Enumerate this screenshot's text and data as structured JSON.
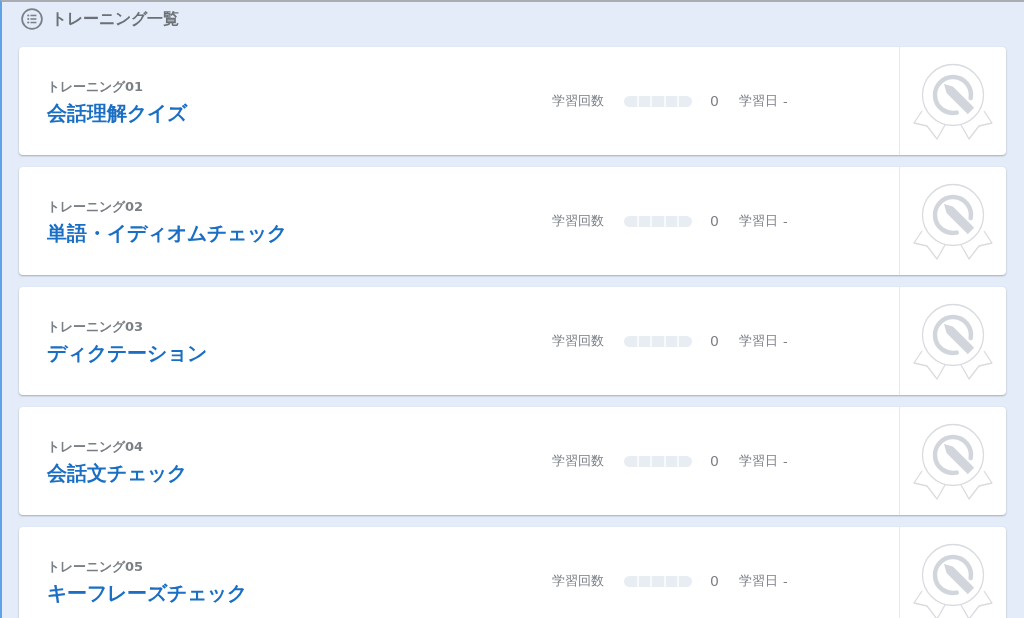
{
  "section": {
    "title": "トレーニング一覧"
  },
  "trainings": [
    {
      "number": "トレーニング01",
      "title": "会話理解クイズ",
      "count_label": "学習回数",
      "level": 0,
      "count": "0",
      "date_label": "学習日",
      "date": "-"
    },
    {
      "number": "トレーニング02",
      "title": "単語・イディオムチェック",
      "count_label": "学習回数",
      "level": 0,
      "count": "0",
      "date_label": "学習日",
      "date": "-"
    },
    {
      "number": "トレーニング03",
      "title": "ディクテーション",
      "count_label": "学習回数",
      "level": 0,
      "count": "0",
      "date_label": "学習日",
      "date": "-"
    },
    {
      "number": "トレーニング04",
      "title": "会話文チェック",
      "count_label": "学習回数",
      "level": 0,
      "count": "0",
      "date_label": "学習日",
      "date": "-"
    },
    {
      "number": "トレーニング05",
      "title": "キーフレーズチェック",
      "count_label": "学習回数",
      "level": 0,
      "count": "0",
      "date_label": "学習日",
      "date": "-"
    }
  ]
}
